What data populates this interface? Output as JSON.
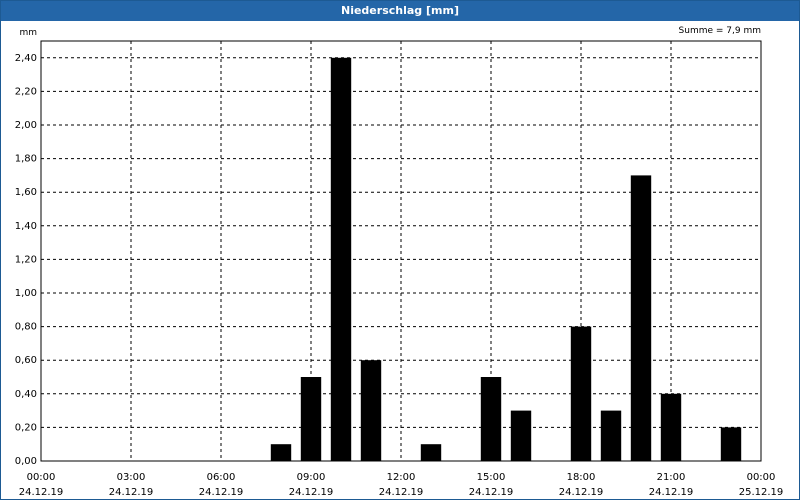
{
  "chart_data": {
    "type": "bar",
    "title": "Niederschlag [mm]",
    "ylabel": "mm",
    "annotation": "Summe = 7,9 mm",
    "ylim": [
      0,
      2.5
    ],
    "y_ticks": [
      "0,00",
      "0,20",
      "0,40",
      "0,60",
      "0,80",
      "1,00",
      "1,20",
      "1,40",
      "1,60",
      "1,80",
      "2,00",
      "2,20",
      "2,40"
    ],
    "x_ticks": [
      {
        "time": "00:00",
        "date": "24.12.19"
      },
      {
        "time": "03:00",
        "date": "24.12.19"
      },
      {
        "time": "06:00",
        "date": "24.12.19"
      },
      {
        "time": "09:00",
        "date": "24.12.19"
      },
      {
        "time": "12:00",
        "date": "24.12.19"
      },
      {
        "time": "15:00",
        "date": "24.12.19"
      },
      {
        "time": "18:00",
        "date": "24.12.19"
      },
      {
        "time": "21:00",
        "date": "24.12.19"
      },
      {
        "time": "00:00",
        "date": "25.12.19"
      }
    ],
    "x_unit": "hour",
    "xlim": [
      0,
      24
    ],
    "grid": true,
    "bar_color": "#000000",
    "bars": [
      {
        "hour": 8,
        "value": 0.1
      },
      {
        "hour": 9,
        "value": 0.5
      },
      {
        "hour": 10,
        "value": 2.4
      },
      {
        "hour": 11,
        "value": 0.6
      },
      {
        "hour": 13,
        "value": 0.1
      },
      {
        "hour": 15,
        "value": 0.5
      },
      {
        "hour": 16,
        "value": 0.3
      },
      {
        "hour": 18,
        "value": 0.8
      },
      {
        "hour": 19,
        "value": 0.3
      },
      {
        "hour": 20,
        "value": 1.7
      },
      {
        "hour": 21,
        "value": 0.4
      },
      {
        "hour": 23,
        "value": 0.2
      }
    ]
  }
}
